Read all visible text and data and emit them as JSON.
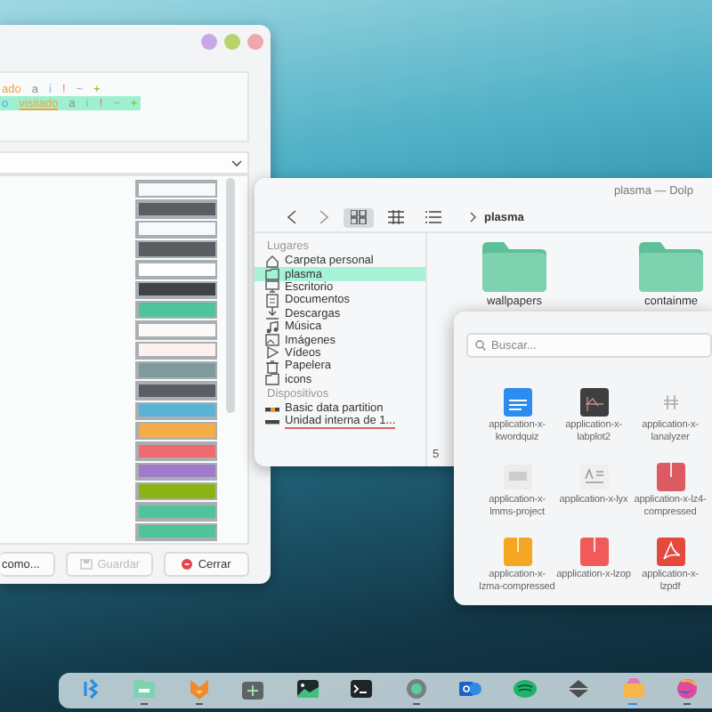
{
  "editor": {
    "preview_lines": [
      {
        "highlighted": false,
        "tokens": [
          {
            "text": "ado",
            "kind": "link",
            "underline": false
          },
          {
            "text": "a",
            "kind": "plain",
            "underline": false
          },
          {
            "text": "i",
            "kind": "info",
            "underline": false
          },
          {
            "text": "!",
            "kind": "alert",
            "underline": false
          },
          {
            "text": "~",
            "kind": "tilde",
            "underline": false
          },
          {
            "text": "+",
            "kind": "plus",
            "underline": false
          }
        ]
      },
      {
        "highlighted": true,
        "tokens": [
          {
            "text": "o",
            "kind": "new",
            "underline": false
          },
          {
            "text": "visitado",
            "kind": "link",
            "underline": true
          },
          {
            "text": "a",
            "kind": "plain",
            "underline": false
          },
          {
            "text": "i",
            "kind": "info",
            "underline": false
          },
          {
            "text": "!",
            "kind": "alert",
            "underline": false
          },
          {
            "text": "~",
            "kind": "tilde",
            "underline": false
          },
          {
            "text": "+",
            "kind": "plus",
            "underline": false
          }
        ]
      }
    ],
    "swatches": [
      {
        "color": "#f8f9fa"
      },
      {
        "color": "#5a5e63"
      },
      {
        "color": "#f8f9fa"
      },
      {
        "color": "#5a5e63"
      },
      {
        "color": "#ffffff"
      },
      {
        "color": "#3f4347"
      },
      {
        "color": "#4fc39a"
      },
      {
        "color": "#fdf9f8"
      },
      {
        "color": "#fdf1ee"
      },
      {
        "color": "#7f9a9c"
      },
      {
        "color": "#5a5e63"
      },
      {
        "color": "#5ab3d6"
      },
      {
        "color": "#f3ae48"
      },
      {
        "color": "#ee6a6e"
      },
      {
        "color": "#a17ac9"
      },
      {
        "color": "#8cb315"
      },
      {
        "color": "#4fc39a"
      },
      {
        "color": "#4fc39a"
      }
    ],
    "buttons": [
      {
        "label": "como...",
        "kind": "plain",
        "disabled": false
      },
      {
        "label": "Guardar",
        "kind": "save",
        "disabled": true
      },
      {
        "label": "Cerrar",
        "kind": "close",
        "disabled": false
      }
    ]
  },
  "file_manager": {
    "title": "plasma — Dolp",
    "view_modes": [
      {
        "kind": "icons",
        "selected": true
      },
      {
        "kind": "compact",
        "selected": false
      },
      {
        "kind": "details",
        "selected": false
      }
    ],
    "breadcrumb": "plasma",
    "sections": [
      {
        "heading": "Lugares",
        "items": [
          {
            "label": "Carpeta personal",
            "kind": "home",
            "selected": false
          },
          {
            "label": "plasma",
            "kind": "folder",
            "selected": true
          },
          {
            "label": "Escritorio",
            "kind": "desktop",
            "selected": false
          },
          {
            "label": "Documentos",
            "kind": "document",
            "selected": false
          },
          {
            "label": "Descargas",
            "kind": "download",
            "selected": false
          },
          {
            "label": "Música",
            "kind": "music",
            "selected": false
          },
          {
            "label": "Imágenes",
            "kind": "image",
            "selected": false
          },
          {
            "label": "Vídeos",
            "kind": "video",
            "selected": false
          },
          {
            "label": "Papelera",
            "kind": "trash",
            "selected": false
          },
          {
            "label": "icons",
            "kind": "folder",
            "selected": false
          }
        ]
      },
      {
        "heading": "Dispositivos",
        "items": [
          {
            "label": "Basic data partition",
            "kind": "drive-active",
            "selected": false
          },
          {
            "label": "Unidad interna de 1...",
            "kind": "drive",
            "selected": false
          }
        ]
      }
    ],
    "folders": [
      {
        "label": "wallpapers"
      },
      {
        "label": "containme"
      }
    ],
    "status": "5"
  },
  "icon_picker": {
    "search_placeholder": "Buscar...",
    "icons": [
      {
        "label": "application-x-kwordquiz",
        "kind": "doc-blue"
      },
      {
        "label": "application-x-labplot2",
        "kind": "plot"
      },
      {
        "label": "application-x-lanalyzer",
        "kind": "hash"
      },
      {
        "label": "application-x-lmms-project",
        "kind": "doc-grey"
      },
      {
        "label": "application-x-lyx",
        "kind": "lyx"
      },
      {
        "label": "application-x-lz4-compressed",
        "kind": "zip-red"
      },
      {
        "label": "application-x-lzma-compressed",
        "kind": "zip-orange"
      },
      {
        "label": "application-x-lzop",
        "kind": "zip-coral"
      },
      {
        "label": "application-x-lzpdf",
        "kind": "pdf"
      }
    ]
  },
  "taskbar": {
    "apps": [
      {
        "kind": "launcher",
        "running": false,
        "active": false
      },
      {
        "kind": "files",
        "running": true,
        "active": false
      },
      {
        "kind": "fox",
        "running": true,
        "active": false
      },
      {
        "kind": "grid",
        "running": false,
        "active": false
      },
      {
        "kind": "photo",
        "running": false,
        "active": false
      },
      {
        "kind": "terminal",
        "running": false,
        "active": false
      },
      {
        "kind": "gear",
        "running": true,
        "active": false
      },
      {
        "kind": "mail",
        "running": false,
        "active": false
      },
      {
        "kind": "music",
        "running": false,
        "active": false
      },
      {
        "kind": "diamond",
        "running": false,
        "active": false
      },
      {
        "kind": "package",
        "running": true,
        "active": true
      },
      {
        "kind": "browser",
        "running": true,
        "active": false
      }
    ]
  }
}
